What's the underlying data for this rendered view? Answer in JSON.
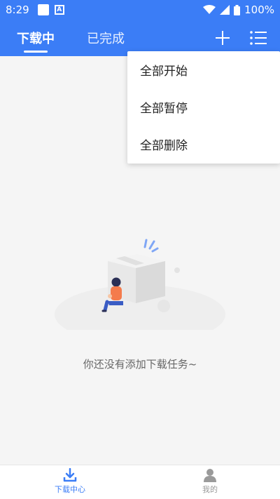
{
  "status_bar": {
    "time": "8:29",
    "battery": "100%"
  },
  "header": {
    "tabs": [
      {
        "label": "下载中",
        "active": true
      },
      {
        "label": "已完成",
        "active": false
      }
    ],
    "add_icon": "plus-icon",
    "menu_icon": "list-icon"
  },
  "menu": {
    "items": [
      {
        "label": "全部开始"
      },
      {
        "label": "全部暂停"
      },
      {
        "label": "全部删除"
      }
    ]
  },
  "empty_state": {
    "message": "你还没有添加下载任务~"
  },
  "bottom_nav": {
    "items": [
      {
        "label": "下载中心",
        "icon": "download-icon",
        "active": true
      },
      {
        "label": "我的",
        "icon": "person-icon",
        "active": false
      }
    ]
  },
  "colors": {
    "primary": "#3b7df6",
    "background": "#f5f5f5",
    "inactive": "#999999"
  }
}
